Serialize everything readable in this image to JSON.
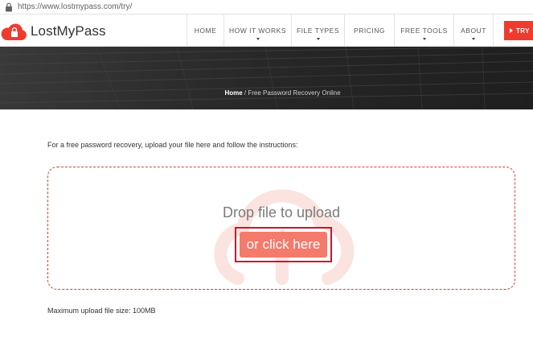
{
  "browser": {
    "url": "https://www.lostmypass.com/try/"
  },
  "brand": {
    "name": "LostMyPass",
    "accent_color": "#ef3b2d"
  },
  "nav": {
    "items": [
      {
        "label": "HOME",
        "dropdown": false
      },
      {
        "label": "HOW IT WORKS",
        "dropdown": true
      },
      {
        "label": "FILE TYPES",
        "dropdown": true
      },
      {
        "label": "PRICING",
        "dropdown": false
      },
      {
        "label": "FREE TOOLS",
        "dropdown": true
      },
      {
        "label": "ABOUT",
        "dropdown": true
      }
    ],
    "cta_label": "TRY"
  },
  "breadcrumb": {
    "home": "Home",
    "separator": " / ",
    "current": "Free Password Recovery Online"
  },
  "main": {
    "instructions": "For a free password recovery, upload your file here and follow the instructions:",
    "dropzone": {
      "title": "Drop file to upload",
      "button_label": "or click here"
    },
    "max_size_note": "Maximum upload file size: 100MB"
  }
}
